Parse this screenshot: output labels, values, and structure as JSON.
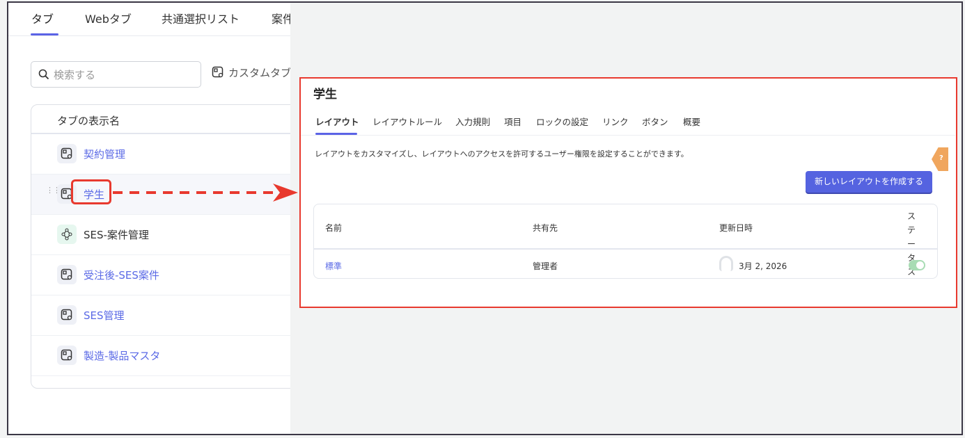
{
  "top_tabs": [
    "タブ",
    "Webタブ",
    "共通選択リスト",
    "案件"
  ],
  "search": {
    "placeholder": "検索する"
  },
  "custom_tab_button": "カスタムタブ",
  "tab_table": {
    "header": "タブの表示名",
    "rows": [
      {
        "label": "契約管理",
        "icon": "custom-tab-icon"
      },
      {
        "label": "学生",
        "icon": "custom-tab-icon"
      },
      {
        "label": "SES-案件管理",
        "icon": "flow-icon"
      },
      {
        "label": "受注後-SES案件",
        "icon": "custom-tab-icon"
      },
      {
        "label": "SES管理",
        "icon": "custom-tab-icon"
      },
      {
        "label": "製造-製品マスタ",
        "icon": "custom-tab-icon"
      }
    ]
  },
  "panel": {
    "title": "学生",
    "tabs": [
      "レイアウト",
      "レイアウトルール",
      "入力規則",
      "項目",
      "ロックの設定",
      "リンク",
      "ボタン",
      "概要"
    ],
    "description": "レイアウトをカスタマイズし、レイアウトへのアクセスを許可するユーザー権限を設定することができます。",
    "new_button": "新しいレイアウトを作成する",
    "columns": [
      "名前",
      "共有先",
      "更新日時",
      "ステータス"
    ],
    "rows": [
      {
        "name": "標準",
        "shared": "管理者",
        "updated": "3月 2, 2026",
        "status_on": true
      }
    ]
  },
  "help_label": "?",
  "colors": {
    "accent": "#5563e0",
    "annotation": "#e8392e"
  }
}
